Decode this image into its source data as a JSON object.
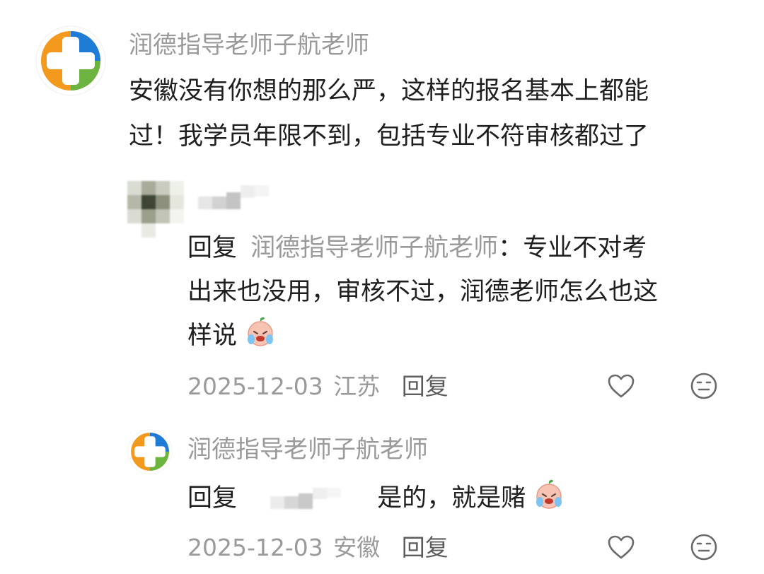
{
  "comment1": {
    "username": "润德指导老师子航老师",
    "line1": "安徽没有你想的那么严，这样的报名基本上都能",
    "line2": "过！我学员年限不到，包括专业不符审核都过了"
  },
  "reply1": {
    "prefix": "回复",
    "target": "润德指导老师子航老师",
    "colon": "：",
    "text_line1": "专业不对考",
    "line2": "出来也没用，审核不过，润德老师怎么也这",
    "line3": "样说",
    "emoji": "crying-face-emoji",
    "date": "2025-12-03",
    "location": "江苏",
    "reply_label": "回复"
  },
  "reply2": {
    "username": "润德指导老师子航老师",
    "prefix": "回复",
    "text": "是的，就是赌",
    "emoji": "crying-face-emoji",
    "date": "2025-12-03",
    "location": "安徽",
    "reply_label": "回复"
  },
  "icons": {
    "like": "heart-outline-icon",
    "dislike": "neutral-face-icon",
    "logo": "cross-logo-icon"
  },
  "colors": {
    "logo_orange": "#F39A1E",
    "logo_blue": "#1E7BD6",
    "logo_green": "#6DB33F",
    "meta_gray": "#9A9A9A"
  }
}
